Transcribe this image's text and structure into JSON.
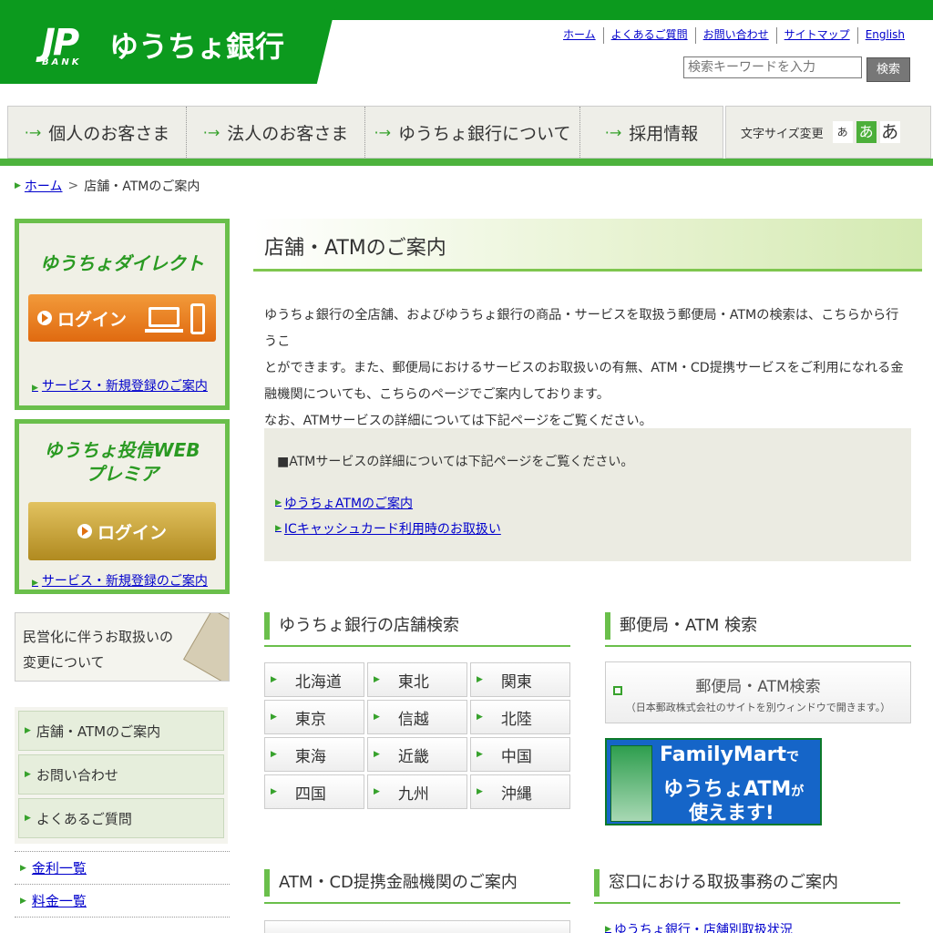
{
  "header": {
    "logo_jp": "JP",
    "logo_bank": "BANK",
    "logo_name": "ゆうちょ銀行",
    "links": [
      "ホーム",
      "よくあるご質問",
      "お問い合わせ",
      "サイトマップ",
      "English"
    ],
    "search": {
      "placeholder": "検索キーワードを入力",
      "button": "検索"
    }
  },
  "nav": {
    "items": [
      "個人のお客さま",
      "法人のお客さま",
      "ゆうちょ銀行について",
      "採用情報"
    ],
    "fontsize_label": "文字サイズ変更",
    "fontsize_options": [
      "あ",
      "あ",
      "あ"
    ]
  },
  "breadcrumb": {
    "home": "ホーム",
    "sep": ">",
    "current": "店舗・ATMのご案内"
  },
  "sidebar": {
    "direct": {
      "title": "ゆうちょダイレクト",
      "login": "ログイン",
      "register": "サービス・新規登録のご案内"
    },
    "premia": {
      "title_1": "ゆうちょ投信WEB",
      "title_2": "プレミア",
      "login": "ログイン",
      "register": "サービス・新規登録のご案内"
    },
    "privatization": {
      "line1": "民営化に伴うお取扱いの",
      "line2": "変更について"
    },
    "menu": [
      "店舗・ATMのご案内",
      "お問い合わせ",
      "よくあるご質問"
    ],
    "links": [
      "金利一覧",
      "料金一覧"
    ]
  },
  "main": {
    "title": "店舗・ATMのご案内",
    "intro_lines": [
      "ゆうちょ銀行の全店舗、およびゆうちょ銀行の商品・サービスを取扱う郵便局・ATMの検索は、こちらから行うこ",
      "とができます。また、郵便局におけるサービスのお取扱いの有無、ATM・CD提携サービスをご利用になれる金",
      "融機関についても、こちらのページでご案内しております。",
      "なお、ATMサービスの詳細については下記ページをご覧ください。"
    ],
    "info": {
      "heading": "■ATMサービスの詳細については下記ページをご覧ください。",
      "links": [
        "ゆうちょATMのご案内",
        "ICキャッシュカード利用時のお取扱い"
      ]
    },
    "store_search": {
      "title": "ゆうちょ銀行の店舗検索",
      "regions": [
        "北海道",
        "東北",
        "関東",
        "東京",
        "信越",
        "北陸",
        "東海",
        "近畿",
        "中国",
        "四国",
        "九州",
        "沖縄"
      ]
    },
    "post_search": {
      "title": "郵便局・ATM 検索",
      "button": "郵便局・ATM検索",
      "note": "（日本郵政株式会社のサイトを別ウィンドウで開きます。）"
    },
    "familymart": {
      "line1": "FamilyMart",
      "line1_suffix": "で",
      "line2": "ゆうちょATM",
      "line2_suffix": "が",
      "line3": "使えます!"
    },
    "atm_cd": {
      "title": "ATM・CD提携金融機関のご案内"
    },
    "counter": {
      "title": "窓口における取扱事務のご案内",
      "link": "ゆうちょ銀行・店舗別取扱状況"
    }
  }
}
